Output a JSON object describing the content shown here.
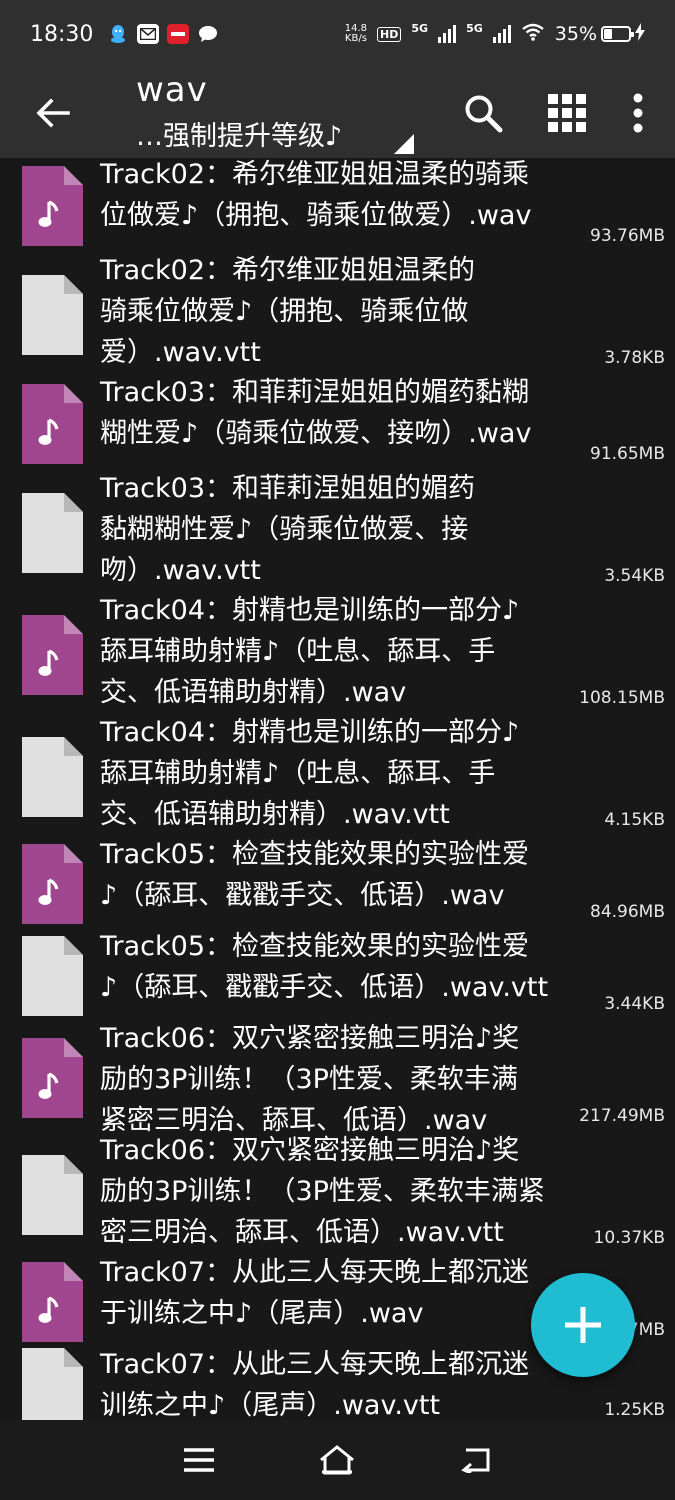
{
  "status_bar": {
    "time": "18:30",
    "net_speed_value": "14.8",
    "net_speed_unit": "KB/s",
    "hd_badge": "HD",
    "sim1_tag": "5G",
    "sim2_tag": "5G",
    "battery_percent": "35%",
    "battery_level": 0.35,
    "notification_icons": [
      "qq-icon",
      "mail-icon",
      "app-badge-icon",
      "chat-bubble-icon"
    ]
  },
  "toolbar": {
    "title": "wav",
    "subtitle": "…强制提升等级♪",
    "back_icon": "arrow-left-icon",
    "search_icon": "search-icon",
    "grid_icon": "grid-view-icon",
    "more_icon": "more-vert-icon"
  },
  "colors": {
    "background": "#181818",
    "toolbar": "#2f2f2f",
    "audio_icon": "#a0468f",
    "doc_icon": "#e0e0e0",
    "fab": "#1fbcd2"
  },
  "files": [
    {
      "type": "audio",
      "name": "Track02：希尔维亚姐姐温柔的骑乘\n位做爱♪（拥抱、骑乘位做爱）.wav",
      "size": "93.76MB"
    },
    {
      "type": "doc",
      "name": "Track02：希尔维亚姐姐温柔的\n骑乘位做爱♪（拥抱、骑乘位做\n爱）.wav.vtt",
      "size": "3.78KB"
    },
    {
      "type": "audio",
      "name": "Track03：和菲莉涅姐姐的媚药黏糊\n糊性爱♪（骑乘位做爱、接吻）.wav",
      "size": "91.65MB"
    },
    {
      "type": "doc",
      "name": "Track03：和菲莉涅姐姐的媚药\n黏糊糊性爱♪（骑乘位做爱、接\n吻）.wav.vtt",
      "size": "3.54KB"
    },
    {
      "type": "audio",
      "name": "Track04：射精也是训练的一部分♪\n舔耳辅助射精♪（吐息、舔耳、手\n交、低语辅助射精）.wav",
      "size": "108.15MB"
    },
    {
      "type": "doc",
      "name": "Track04：射精也是训练的一部分♪\n舔耳辅助射精♪（吐息、舔耳、手\n交、低语辅助射精）.wav.vtt",
      "size": "4.15KB"
    },
    {
      "type": "audio",
      "name": "Track05：检查技能效果的实验性爱\n♪（舔耳、戳戳手交、低语）.wav",
      "size": "84.96MB"
    },
    {
      "type": "doc",
      "name": "Track05：检查技能效果的实验性爱\n♪（舔耳、戳戳手交、低语）.wav.vtt",
      "size": "3.44KB"
    },
    {
      "type": "audio",
      "name": "Track06：双穴紧密接触三明治♪奖\n励的3P训练！（3P性爱、柔软丰满\n紧密三明治、舔耳、低语）.wav",
      "size": "217.49MB"
    },
    {
      "type": "doc",
      "name": "Track06：双穴紧密接触三明治♪奖\n励的3P训练！（3P性爱、柔软丰满紧\n密三明治、舔耳、低语）.wav.vtt",
      "size": "10.37KB"
    },
    {
      "type": "audio",
      "name": "Track07：从此三人每天晚上都沉迷\n于训练之中♪（尾声）.wav",
      "size": "7MB"
    },
    {
      "type": "doc",
      "name": "Track07：从此三人每天晚上都沉迷\n训练之中♪（尾声）.wav.vtt",
      "size": "1.25KB"
    }
  ],
  "fab": {
    "icon": "plus-icon"
  },
  "nav_bar": {
    "recents_icon": "menu-icon",
    "home_icon": "home-icon",
    "back_icon": "back-icon"
  }
}
